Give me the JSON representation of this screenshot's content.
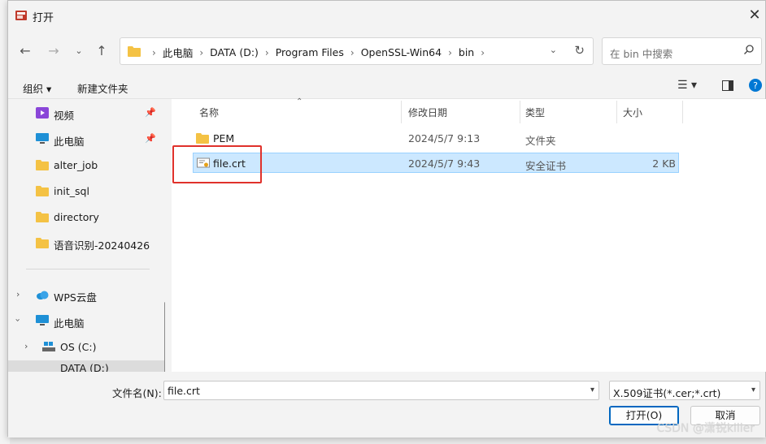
{
  "window": {
    "title": "打开",
    "close": "✕"
  },
  "navbar": {
    "breadcrumbs": [
      "此电脑",
      "DATA (D:)",
      "Program Files",
      "OpenSSL-Win64",
      "bin"
    ],
    "search_placeholder": "在 bin 中搜索"
  },
  "toolbar": {
    "organize": "组织 ▾",
    "new_folder": "新建文件夹"
  },
  "sidebar": {
    "items": [
      {
        "label": "视频",
        "icon": "video-icon",
        "pinned": true
      },
      {
        "label": "此电脑",
        "icon": "pc-icon",
        "pinned": true
      },
      {
        "label": "alter_job",
        "icon": "folder-icon"
      },
      {
        "label": "init_sql",
        "icon": "folder-icon"
      },
      {
        "label": "directory",
        "icon": "folder-icon"
      },
      {
        "label": "语音识别-20240426",
        "icon": "folder-icon"
      },
      {
        "label": "WPS云盘",
        "icon": "cloud-icon"
      },
      {
        "label": "此电脑",
        "icon": "pc-icon"
      },
      {
        "label": "OS (C:)",
        "icon": "drive-icon"
      },
      {
        "label": "DATA (D:)",
        "icon": "drive-icon"
      }
    ]
  },
  "columns": [
    "名称",
    "修改日期",
    "类型",
    "大小"
  ],
  "files": [
    {
      "name": "PEM",
      "date": "2024/5/7 9:13",
      "type": "文件夹",
      "size": "",
      "icon": "folder-icon"
    },
    {
      "name": "file.crt",
      "date": "2024/5/7 9:43",
      "type": "安全证书",
      "size": "2 KB",
      "icon": "certificate-icon"
    }
  ],
  "bottom": {
    "filename_label": "文件名(N):",
    "filename_value": "file.crt",
    "filetype_value": "X.509证书(*.cer;*.crt)",
    "open_label": "打开(O)",
    "cancel_label": "取消"
  },
  "watermark": "CSDN @潇锐killer",
  "colors": {
    "selection": "#cce8ff",
    "annotation": "#e0312b",
    "folder": "#f4c244",
    "accent": "#0067c0"
  }
}
